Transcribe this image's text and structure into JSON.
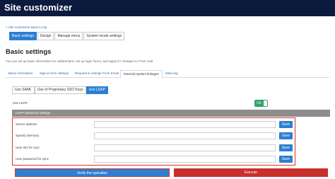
{
  "header": {
    "title": "Site customizer"
  },
  "back_link": "< Site customizer Back to top",
  "top_tabs": [
    {
      "label": "Basic settings",
      "active": true
    },
    {
      "label": "Design",
      "active": false
    },
    {
      "label": "Manage menu",
      "active": false
    },
    {
      "label": "System locale settings",
      "active": false
    }
  ],
  "page": {
    "heading": "Basic settings",
    "description": "You can set up basic information for subdomains, set up login forms, and apply for changes to From mail."
  },
  "sub_tabs": [
    {
      "label": "Basic information",
      "active": false
    },
    {
      "label": "Sign-in form settings",
      "active": false
    },
    {
      "label": "Request to change From Email",
      "active": false
    },
    {
      "label": "External system linkages",
      "active": true
    },
    {
      "label": "Meta tag",
      "active": false
    }
  ],
  "auth_tabs": [
    {
      "label": "Use SAML",
      "active": false
    },
    {
      "label": "Use of Proprietary SSO Keys",
      "active": false
    },
    {
      "label": "Use LDAP",
      "active": true
    }
  ],
  "use_ldap": {
    "label": "Use LDAP",
    "toggle_text": "On"
  },
  "section": {
    "title": "LDAP advanced settings"
  },
  "fields": [
    {
      "label": "Server address",
      "value": "",
      "save_label": "Save"
    },
    {
      "label": "Specify directory",
      "value": "",
      "save_label": "Save"
    },
    {
      "label": "User IDs for sync",
      "value": "",
      "save_label": "Save"
    },
    {
      "label": "User password for sync",
      "value": "",
      "save_label": "Save"
    }
  ],
  "actions": {
    "verify_label": "Verify the operation",
    "execute_label": "Execute"
  },
  "colors": {
    "header_bg": "#0b1b3d",
    "accent": "#2c7fd1",
    "toggle_on": "#2ea36a",
    "danger": "#c9302c",
    "highlight_border": "#d9342b"
  }
}
